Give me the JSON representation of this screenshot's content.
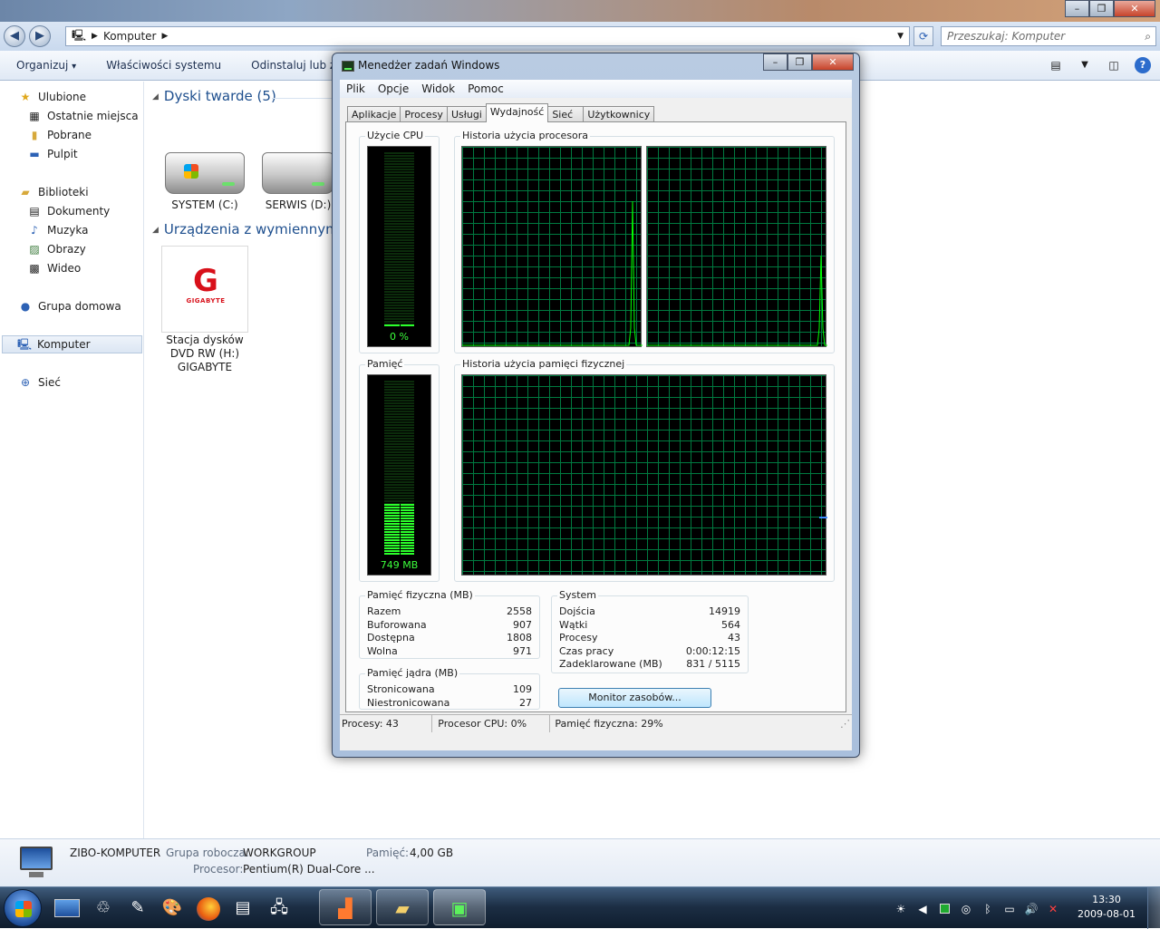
{
  "explorer": {
    "address_path": "Komputer",
    "search_placeholder": "Przeszukaj: Komputer",
    "commands": [
      "Organizuj",
      "Właściwości systemu",
      "Odinstaluj lub zmień"
    ],
    "organize_arrow": "▾",
    "nav": {
      "favorites": "Ulubione",
      "recent": "Ostatnie miejsca",
      "downloads": "Pobrane",
      "desktop": "Pulpit",
      "libraries": "Biblioteki",
      "documents": "Dokumenty",
      "music": "Muzyka",
      "pictures": "Obrazy",
      "video": "Wideo",
      "homegroup": "Grupa domowa",
      "computer": "Komputer",
      "network": "Sieć"
    },
    "groups": {
      "hard_disks": "Dyski twarde (5)",
      "removable": "Urządzenia z wymiennymi n"
    },
    "drives": [
      {
        "label": "SYSTEM (C:)"
      },
      {
        "label": "SERWIS (D:)"
      }
    ],
    "dvd": {
      "line1": "Stacja dysków",
      "line2": "DVD RW (H:)",
      "line3": "GIGABYTE",
      "logo_text": "GIGABYTE"
    },
    "details": {
      "computer_name": "ZIBO-KOMPUTER",
      "workgroup_label": "Grupa robocza:",
      "workgroup_value": "WORKGROUP",
      "memory_label": "Pamięć:",
      "memory_value": "4,00 GB",
      "processor_label": "Procesor:",
      "processor_value": "Pentium(R) Dual-Core ..."
    }
  },
  "taskmanager": {
    "title": "Menedżer zadań Windows",
    "menu": [
      "Plik",
      "Opcje",
      "Widok",
      "Pomoc"
    ],
    "tabs": [
      "Aplikacje",
      "Procesy",
      "Usługi",
      "Wydajność",
      "Sieć",
      "Użytkownicy"
    ],
    "active_tab_index": 3,
    "cpu_usage": {
      "title": "Użycie CPU",
      "label": "0 %",
      "fraction": 0.0
    },
    "cpu_history": {
      "title": "Historia użycia procesora"
    },
    "memory": {
      "title": "Pamięć",
      "label": "749 MB",
      "fraction": 0.29
    },
    "memory_history": {
      "title": "Historia użycia pamięci fizycznej"
    },
    "physical": {
      "title": "Pamięć fizyczna (MB)",
      "rows": [
        {
          "k": "Razem",
          "v": "2558"
        },
        {
          "k": "Buforowana",
          "v": "907"
        },
        {
          "k": "Dostępna",
          "v": "1808"
        },
        {
          "k": "Wolna",
          "v": "971"
        }
      ]
    },
    "kernel": {
      "title": "Pamięć jądra (MB)",
      "rows": [
        {
          "k": "Stronicowana",
          "v": "109"
        },
        {
          "k": "Niestronicowana",
          "v": "27"
        }
      ]
    },
    "system": {
      "title": "System",
      "rows": [
        {
          "k": "Dojścia",
          "v": "14919"
        },
        {
          "k": "Wątki",
          "v": "564"
        },
        {
          "k": "Procesy",
          "v": "43"
        },
        {
          "k": "Czas pracy",
          "v": "0:00:12:15"
        },
        {
          "k": "Zadeklarowane (MB)",
          "v": "831 / 5115"
        }
      ]
    },
    "monitor_button": "Monitor zasobów...",
    "status": {
      "processes": "Procesy: 43",
      "cpu": "Procesor CPU: 0%",
      "memory": "Pamięć fizyczna: 29%"
    }
  },
  "taskbar": {
    "time": "13:30",
    "date": "2009-08-01"
  },
  "colors": {
    "graph_line": "#00ff00",
    "grid": "#007a40",
    "link_blue": "#1e4f8e"
  }
}
